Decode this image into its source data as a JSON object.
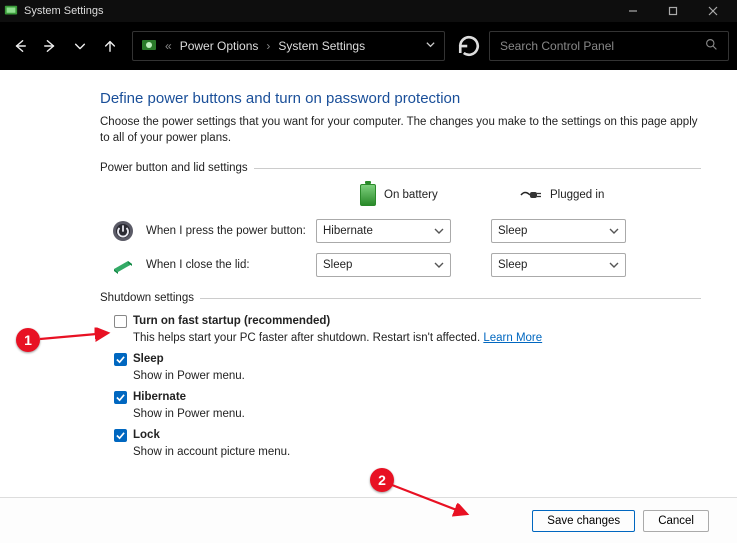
{
  "window": {
    "title": "System Settings"
  },
  "toolbar": {
    "breadcrumb_prefix": "«",
    "crumb1": "Power Options",
    "crumb2": "System Settings",
    "search_placeholder": "Search Control Panel"
  },
  "page": {
    "heading": "Define power buttons and turn on password protection",
    "description": "Choose the power settings that you want for your computer. The changes you make to the settings on this page apply to all of your power plans.",
    "section_power": "Power button and lid settings",
    "col_battery": "On battery",
    "col_plugged": "Plugged in",
    "row_powerbtn": "When I press the power button:",
    "row_lid": "When I close the lid:",
    "dd_powerbtn_batt": "Hibernate",
    "dd_powerbtn_plug": "Sleep",
    "dd_lid_batt": "Sleep",
    "dd_lid_plug": "Sleep",
    "section_shutdown": "Shutdown settings",
    "fast_title": "Turn on fast startup (recommended)",
    "fast_sub": "This helps start your PC faster after shutdown. Restart isn't affected. ",
    "fast_link": "Learn More",
    "sleep_title": "Sleep",
    "sleep_sub": "Show in Power menu.",
    "hib_title": "Hibernate",
    "hib_sub": "Show in Power menu.",
    "lock_title": "Lock",
    "lock_sub": "Show in account picture menu."
  },
  "footer": {
    "save": "Save changes",
    "cancel": "Cancel"
  },
  "annotations": {
    "one": "1",
    "two": "2"
  }
}
